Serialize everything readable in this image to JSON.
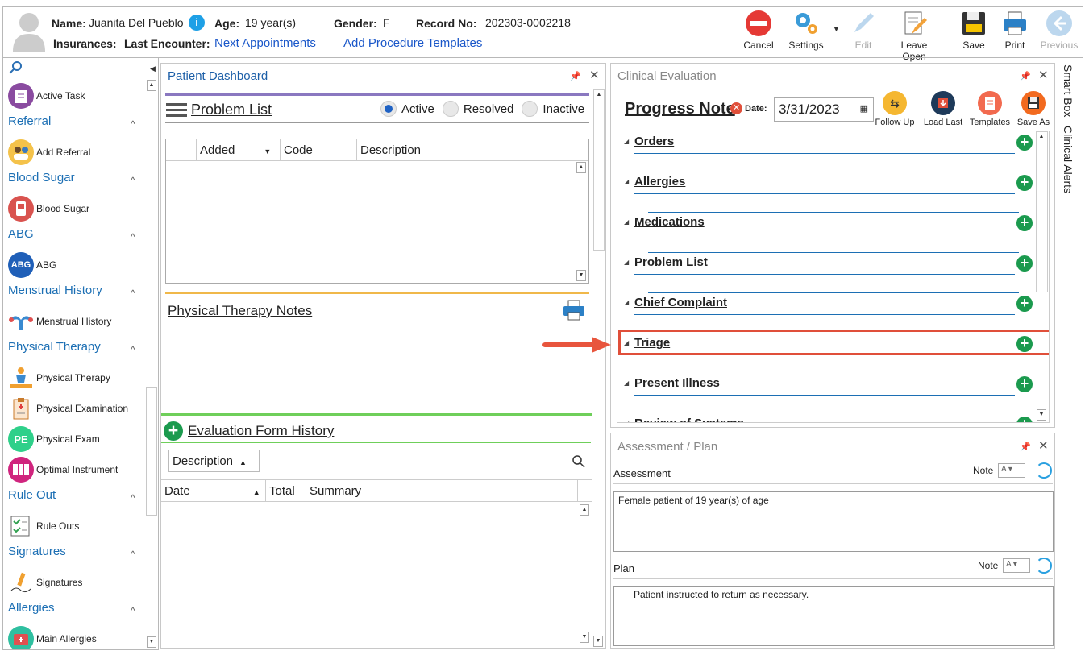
{
  "header": {
    "name_label": "Name:",
    "name_value": "Juanita Del Pueblo",
    "age_label": "Age:",
    "age_value": "19 year(s)",
    "gender_label": "Gender:",
    "gender_value": "F",
    "record_label": "Record No:",
    "record_value": "202303-0002218",
    "insurances_label": "Insurances:",
    "last_encounter_label": "Last Encounter:",
    "next_appointments": "Next Appointments",
    "add_procedure_templates": "Add Procedure Templates",
    "info_icon": "i"
  },
  "toolbar": {
    "cancel": "Cancel",
    "settings": "Settings",
    "edit": "Edit",
    "leave_open": "Leave Open",
    "save": "Save",
    "print": "Print",
    "previous": "Previous"
  },
  "sidebar": {
    "active_task": "Active Task",
    "sections": [
      {
        "title": "Referral",
        "item": "Add Referral"
      },
      {
        "title": "Blood Sugar",
        "item": "Blood Sugar"
      },
      {
        "title": "ABG",
        "item": "ABG",
        "icon_text": "ABG"
      },
      {
        "title": "Menstrual History",
        "item": "Menstrual History"
      },
      {
        "title": "Physical Therapy",
        "items": [
          "Physical Therapy",
          "Physical Examination",
          "Physical Exam",
          "Optimal Instrument"
        ],
        "pe_icon_text": "PE"
      },
      {
        "title": "Rule Out",
        "item": "Rule Outs"
      },
      {
        "title": "Signatures",
        "item": "Signatures"
      },
      {
        "title": "Allergies",
        "item": "Main Allergies"
      }
    ]
  },
  "dashboard": {
    "title": "Patient Dashboard",
    "problem_list": "Problem List",
    "radios": [
      "Active",
      "Resolved",
      "Inactive"
    ],
    "selected_radio": "Active",
    "columns": [
      "Added",
      "Code",
      "Description"
    ],
    "pt_notes": "Physical Therapy Notes",
    "eval_history": "Evaluation Form History",
    "eval_filter": "Description",
    "eval_columns": [
      "Date",
      "Total",
      "Summary"
    ]
  },
  "clinical": {
    "title": "Clinical Evaluation",
    "progress_note": "Progress Note",
    "date_label": "Date:",
    "date_value": "3/31/2023",
    "buttons": [
      "Follow Up",
      "Load Last",
      "Templates",
      "Save As"
    ],
    "sections": [
      "Orders",
      "Allergies",
      "Medications",
      "Problem List",
      "Chief Complaint",
      "Triage",
      "Present Illness",
      "Review of Systems"
    ],
    "highlighted": "Triage"
  },
  "side_tabs": [
    "Smart Box",
    "Clinical Alerts"
  ],
  "assessment": {
    "title": "Assessment / Plan",
    "assessment_label": "Assessment",
    "note_label": "Note",
    "assessment_text": "Female patient of 19 year(s) of age",
    "plan_label": "Plan",
    "plan_text": "Patient instructed to return as necessary."
  },
  "colors": {
    "accent_blue": "#1c6fb4",
    "link": "#1a57c9",
    "highlight_red": "#e04f3a",
    "green_plus": "#1b9a4e"
  }
}
